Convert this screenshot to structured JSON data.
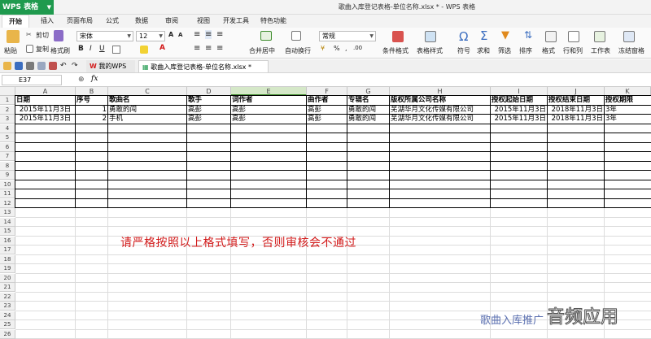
{
  "app": {
    "name": "WPS 表格",
    "window_title": "歌曲入库登记表格-单位名称.xlsx * - WPS 表格"
  },
  "menu": [
    "开始",
    "插入",
    "页面布局",
    "公式",
    "数据",
    "审阅",
    "视图",
    "开发工具",
    "特色功能"
  ],
  "ribbon": {
    "paste": "粘贴",
    "cut": "剪切",
    "copy": "复制",
    "format_painter": "格式刷",
    "font_name": "宋体",
    "font_size": "12",
    "merge_center": "合并居中",
    "wrap": "自动换行",
    "number_format": "常规",
    "cond_format": "条件格式",
    "table_style": "表格样式",
    "symbol": "符号",
    "sum": "求和",
    "filter": "筛选",
    "sort": "排序",
    "format": "格式",
    "rowcol": "行和列",
    "worksheet": "工作表",
    "freeze": "冻结窗格"
  },
  "tabs": {
    "my_wps": "我的WPS",
    "doc": "歌曲入库登记表格-单位名称.xlsx *"
  },
  "formula_bar": {
    "cell_ref": "E37",
    "fx": "fx",
    "formula": ""
  },
  "columns": [
    "A",
    "B",
    "C",
    "D",
    "E",
    "F",
    "G",
    "H",
    "I",
    "J",
    "K"
  ],
  "selected_column": "E",
  "rows": [
    "1",
    "2",
    "3",
    "4",
    "5",
    "6",
    "7",
    "8",
    "9",
    "10",
    "11",
    "12",
    "13",
    "14",
    "15",
    "16",
    "17",
    "18",
    "19",
    "20",
    "21",
    "22",
    "23",
    "24",
    "25",
    "26"
  ],
  "sheet": {
    "headers": [
      "日期",
      "序号",
      "歌曲名",
      "歌手",
      "词作者",
      "曲作者",
      "专辑名",
      "版权所属公司名称",
      "授权起始日期",
      "授权结束日期",
      "授权期限"
    ],
    "records": [
      [
        "2015年11月3日",
        "1",
        "勇敢的闯",
        "高彭",
        "高彭",
        "高彭",
        "勇敢的闯",
        "芜湖华月文化传媒有限公司",
        "2015年11月3日",
        "2018年11月3日",
        "3年"
      ],
      [
        "2015年11月3日",
        "2",
        "手机",
        "高彭",
        "高彭",
        "高彭",
        "勇敢的闯",
        "芜湖华月文化传媒有限公司",
        "2015年11月3日",
        "2018年11月3日",
        "3年"
      ]
    ]
  },
  "note": "请严格按照以上格式填写，否则审核会不通过",
  "watermark": {
    "caption": "歌曲入库推广",
    "brand": "音频应用"
  },
  "colors": {
    "app_green": "#1f9a4e",
    "note_red": "#d21a1a",
    "selected_col": "#d5e8c8"
  }
}
